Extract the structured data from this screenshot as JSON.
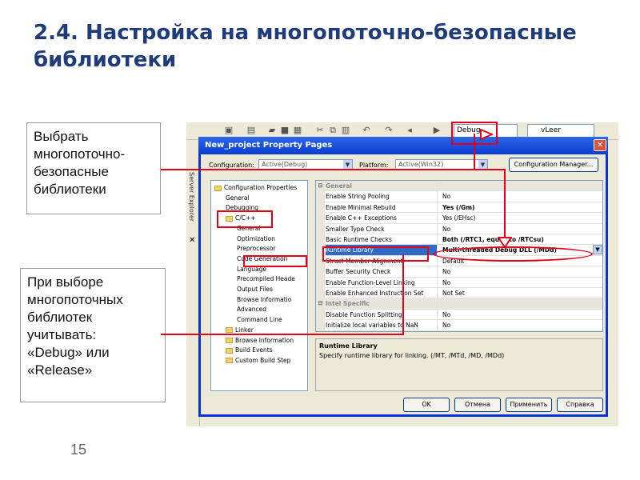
{
  "slide": {
    "title": "2.4. Настройка на многопоточно-безопасные библиотеки",
    "note1": "Выбрать\nмногопоточно-\nбезопасные\nбиблиотеки",
    "note2": "При выборе\nмногопоточных\nбиблиотек\nучитывать:\n«Debug» или\n«Release»",
    "page_number": "15"
  },
  "toolbar": {
    "config_combo": "Debug",
    "second_combo": "vLeer"
  },
  "side_panel": {
    "label": "Server Explorer"
  },
  "dialog": {
    "title": "New_project Property Pages",
    "close_label": "✕",
    "configuration_label": "Configuration:",
    "configuration_value": "Active(Debug)",
    "platform_label": "Platform:",
    "platform_value": "Active(Win32)",
    "config_manager_button": "Configuration Manager...",
    "tree": [
      {
        "label": "Configuration Properties",
        "level": 0,
        "folder": true
      },
      {
        "label": "General",
        "level": 1,
        "folder": false
      },
      {
        "label": "Debugging",
        "level": 1,
        "folder": false
      },
      {
        "label": "C/C++",
        "level": 1,
        "folder": true
      },
      {
        "label": "General",
        "level": 2,
        "folder": false
      },
      {
        "label": "Optimization",
        "level": 2,
        "folder": false
      },
      {
        "label": "Preprocessor",
        "level": 2,
        "folder": false
      },
      {
        "label": "Code Generation",
        "level": 2,
        "folder": false
      },
      {
        "label": "Language",
        "level": 2,
        "folder": false
      },
      {
        "label": "Precompiled Heade",
        "level": 2,
        "folder": false
      },
      {
        "label": "Output Files",
        "level": 2,
        "folder": false
      },
      {
        "label": "Browse Informatio",
        "level": 2,
        "folder": false
      },
      {
        "label": "Advanced",
        "level": 2,
        "folder": false
      },
      {
        "label": "Command Line",
        "level": 2,
        "folder": false
      },
      {
        "label": "Linker",
        "level": 1,
        "folder": true
      },
      {
        "label": "Browse Information",
        "level": 1,
        "folder": true
      },
      {
        "label": "Build Events",
        "level": 1,
        "folder": true
      },
      {
        "label": "Custom Build Step",
        "level": 1,
        "folder": true
      }
    ],
    "grid": [
      {
        "category": true,
        "name": "General",
        "value": ""
      },
      {
        "name": "Enable String Pooling",
        "value": "No"
      },
      {
        "name": "Enable Minimal Rebuild",
        "value": "Yes (/Gm)",
        "bold": true
      },
      {
        "name": "Enable C++ Exceptions",
        "value": "Yes (/EHsc)"
      },
      {
        "name": "Smaller Type Check",
        "value": "No"
      },
      {
        "name": "Basic Runtime Checks",
        "value": "Both (/RTC1, equiv. to /RTCsu)",
        "bold": true
      },
      {
        "name": "Runtime Library",
        "value": "Multi-threaded Debug DLL (/MDd)",
        "bold": true,
        "selected": true
      },
      {
        "name": "Struct Member Alignment",
        "value": "Default"
      },
      {
        "name": "Buffer Security Check",
        "value": "No"
      },
      {
        "name": "Enable Function-Level Linking",
        "value": "No"
      },
      {
        "name": "Enable Enhanced Instruction Set",
        "value": "Not Set"
      },
      {
        "category": true,
        "name": "Intel Specific",
        "value": ""
      },
      {
        "name": "Disable Function Splitting",
        "value": "No"
      },
      {
        "name": "Initialize local variables to NaN",
        "value": "No"
      }
    ],
    "description_title": "Runtime Library",
    "description_text": "Specify runtime library for linking.    (/MT, /MTd, /MD, /MDd)",
    "ok_button": "OK",
    "cancel_button": "Отмена",
    "apply_button": "Применить",
    "help_button": "Справка"
  },
  "colors": {
    "title": "#1f3b7a",
    "highlight": "#e0001b",
    "dialog_frame": "#0831d9"
  }
}
